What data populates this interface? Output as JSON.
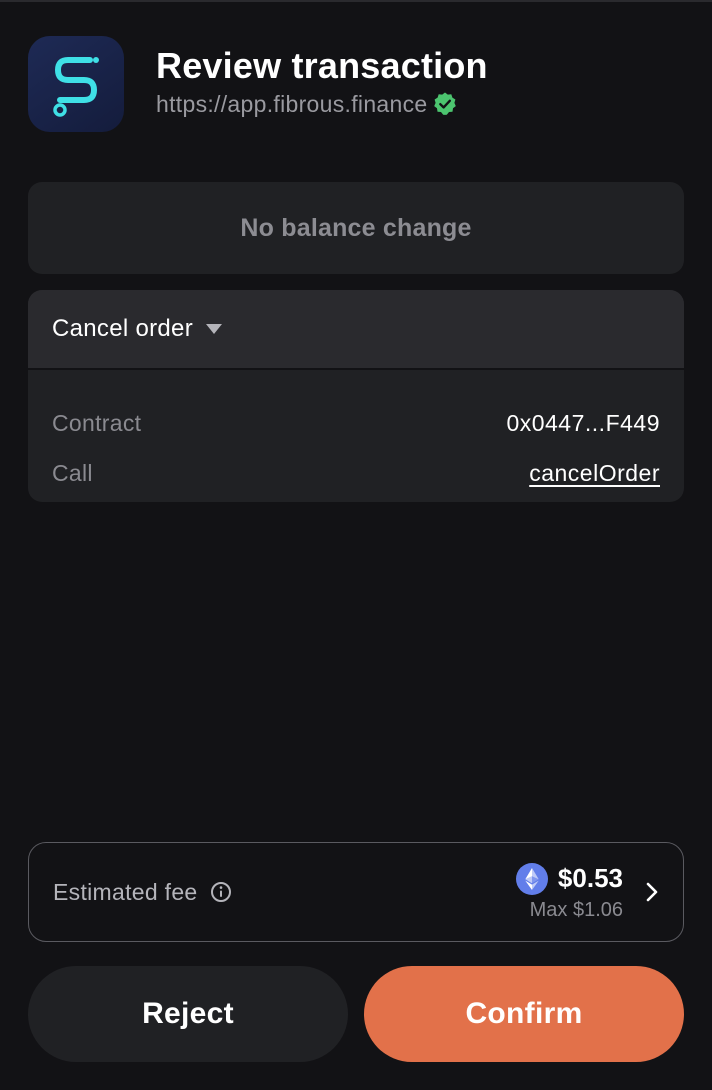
{
  "header": {
    "title": "Review transaction",
    "origin": "https://app.fibrous.finance",
    "logo_icon": "fibrous-logo-icon",
    "verified_icon": "verified-check-icon"
  },
  "balance": {
    "text": "No balance change"
  },
  "transaction": {
    "title": "Cancel order",
    "toggle_icon": "caret-down-icon",
    "rows": [
      {
        "label": "Contract",
        "value": "0x0447...F449"
      },
      {
        "label": "Call",
        "value": "cancelOrder"
      }
    ]
  },
  "fee": {
    "label": "Estimated fee",
    "info_icon": "info-icon",
    "token_icon": "eth-icon",
    "amount": "$0.53",
    "max": "Max $1.06",
    "expand_icon": "chevron-right-icon"
  },
  "actions": {
    "reject_label": "Reject",
    "confirm_label": "Confirm"
  },
  "colors": {
    "background": "#121215",
    "card": "#202124",
    "card_header": "#2a2a2e",
    "accent": "#e2714a",
    "verified": "#4cc46f",
    "logo_cyan": "#3fe0e6",
    "eth": "#627eea"
  }
}
